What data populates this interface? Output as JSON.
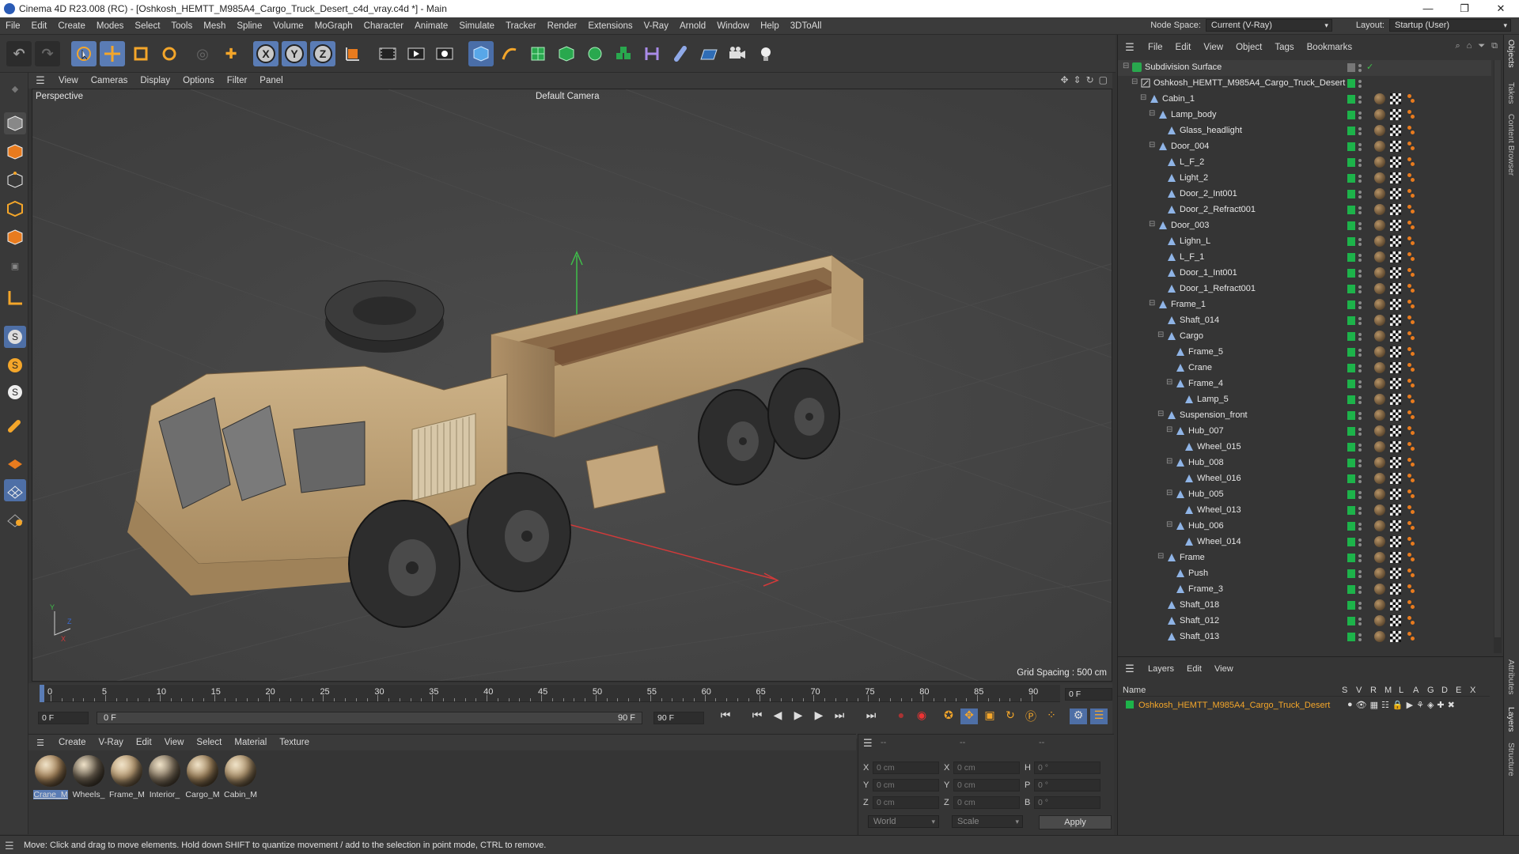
{
  "window": {
    "title": "Cinema 4D R23.008 (RC) - [Oshkosh_HEMTT_M985A4_Cargo_Truck_Desert_c4d_vray.c4d *] - Main",
    "controls": [
      "—",
      "❐",
      "✕"
    ]
  },
  "menubar": {
    "items": [
      "File",
      "Edit",
      "Create",
      "Modes",
      "Select",
      "Tools",
      "Mesh",
      "Spline",
      "Volume",
      "MoGraph",
      "Character",
      "Animate",
      "Simulate",
      "Tracker",
      "Render",
      "Extensions",
      "V-Ray",
      "Arnold",
      "Window",
      "Help",
      "3DToAll"
    ],
    "node_space_label": "Node Space:",
    "node_space_value": "Current (V-Ray)",
    "layout_label": "Layout:",
    "layout_value": "Startup (User)"
  },
  "viewport": {
    "menu": [
      "View",
      "Cameras",
      "Display",
      "Options",
      "Filter",
      "Panel"
    ],
    "view_name": "Perspective",
    "camera": "Default Camera",
    "grid_spacing": "Grid Spacing : 500 cm"
  },
  "timeline": {
    "ticks": [
      "0",
      "5",
      "10",
      "15",
      "20",
      "25",
      "30",
      "35",
      "40",
      "45",
      "50",
      "55",
      "60",
      "65",
      "70",
      "75",
      "80",
      "85",
      "90"
    ],
    "current_frame": "0 F",
    "start_frame": "0 F",
    "range_start": "0 F",
    "range_end": "90 F",
    "end_frame": "90 F"
  },
  "materials": {
    "menu": [
      "Create",
      "V-Ray",
      "Edit",
      "View",
      "Select",
      "Material",
      "Texture"
    ],
    "items": [
      {
        "name": "Crane_M",
        "color": "#b08d62"
      },
      {
        "name": "Wheels_",
        "color": "#6e6353"
      },
      {
        "name": "Frame_M",
        "color": "#c2a47a"
      },
      {
        "name": "Interior_",
        "color": "#8a7b66"
      },
      {
        "name": "Cargo_M",
        "color": "#a58860"
      },
      {
        "name": "Cabin_M",
        "color": "#b69a72"
      }
    ]
  },
  "coordinates": {
    "header": [
      "--",
      "--",
      "--"
    ],
    "rows": [
      {
        "a": "X",
        "av": "0 cm",
        "b": "X",
        "bv": "0 cm",
        "c": "H",
        "cv": "0 °"
      },
      {
        "a": "Y",
        "av": "0 cm",
        "b": "Y",
        "bv": "0 cm",
        "c": "P",
        "cv": "0 °"
      },
      {
        "a": "Z",
        "av": "0 cm",
        "b": "Z",
        "bv": "0 cm",
        "c": "B",
        "cv": "0 °"
      }
    ],
    "space": "World",
    "mode": "Scale",
    "apply": "Apply"
  },
  "status": "Move: Click and drag to move elements. Hold down SHIFT to quantize movement / add to the selection in point mode, CTRL to remove.",
  "objects": {
    "menu": [
      "File",
      "Edit",
      "View",
      "Object",
      "Tags",
      "Bookmarks"
    ],
    "rows": [
      {
        "name": "Subdivision Surface",
        "depth": 0
      },
      {
        "name": "Oshkosh_HEMTT_M985A4_Cargo_Truck_Desert",
        "depth": 1
      },
      {
        "name": "Cabin_1",
        "depth": 2
      },
      {
        "name": "Lamp_body",
        "depth": 3
      },
      {
        "name": "Glass_headlight",
        "depth": 4
      },
      {
        "name": "Door_004",
        "depth": 3
      },
      {
        "name": "L_F_2",
        "depth": 4
      },
      {
        "name": "Light_2",
        "depth": 4
      },
      {
        "name": "Door_2_Int001",
        "depth": 4
      },
      {
        "name": "Door_2_Refract001",
        "depth": 4
      },
      {
        "name": "Door_003",
        "depth": 3
      },
      {
        "name": "Lighn_L",
        "depth": 4
      },
      {
        "name": "L_F_1",
        "depth": 4
      },
      {
        "name": "Door_1_Int001",
        "depth": 4
      },
      {
        "name": "Door_1_Refract001",
        "depth": 4
      },
      {
        "name": "Frame_1",
        "depth": 3
      },
      {
        "name": "Shaft_014",
        "depth": 4
      },
      {
        "name": "Cargo",
        "depth": 4
      },
      {
        "name": "Frame_5",
        "depth": 5
      },
      {
        "name": "Crane",
        "depth": 5
      },
      {
        "name": "Frame_4",
        "depth": 5
      },
      {
        "name": "Lamp_5",
        "depth": 6
      },
      {
        "name": "Suspension_front",
        "depth": 4
      },
      {
        "name": "Hub_007",
        "depth": 5
      },
      {
        "name": "Wheel_015",
        "depth": 6
      },
      {
        "name": "Hub_008",
        "depth": 5
      },
      {
        "name": "Wheel_016",
        "depth": 6
      },
      {
        "name": "Hub_005",
        "depth": 5
      },
      {
        "name": "Wheel_013",
        "depth": 6
      },
      {
        "name": "Hub_006",
        "depth": 5
      },
      {
        "name": "Wheel_014",
        "depth": 6
      },
      {
        "name": "Frame",
        "depth": 4
      },
      {
        "name": "Push",
        "depth": 5
      },
      {
        "name": "Frame_3",
        "depth": 5
      },
      {
        "name": "Shaft_018",
        "depth": 4
      },
      {
        "name": "Shaft_012",
        "depth": 4
      },
      {
        "name": "Shaft_013",
        "depth": 4
      }
    ]
  },
  "layers": {
    "menu": [
      "Layers",
      "Edit",
      "View"
    ],
    "columns": [
      "Name",
      "S",
      "V",
      "R",
      "M",
      "L",
      "A",
      "G",
      "D",
      "E",
      "X"
    ],
    "row": "Oshkosh_HEMTT_M985A4_Cargo_Truck_Desert"
  },
  "side_tabs": [
    "Objects",
    "Takes",
    "Content Browser",
    "Attributes",
    "Layers",
    "Structure"
  ]
}
